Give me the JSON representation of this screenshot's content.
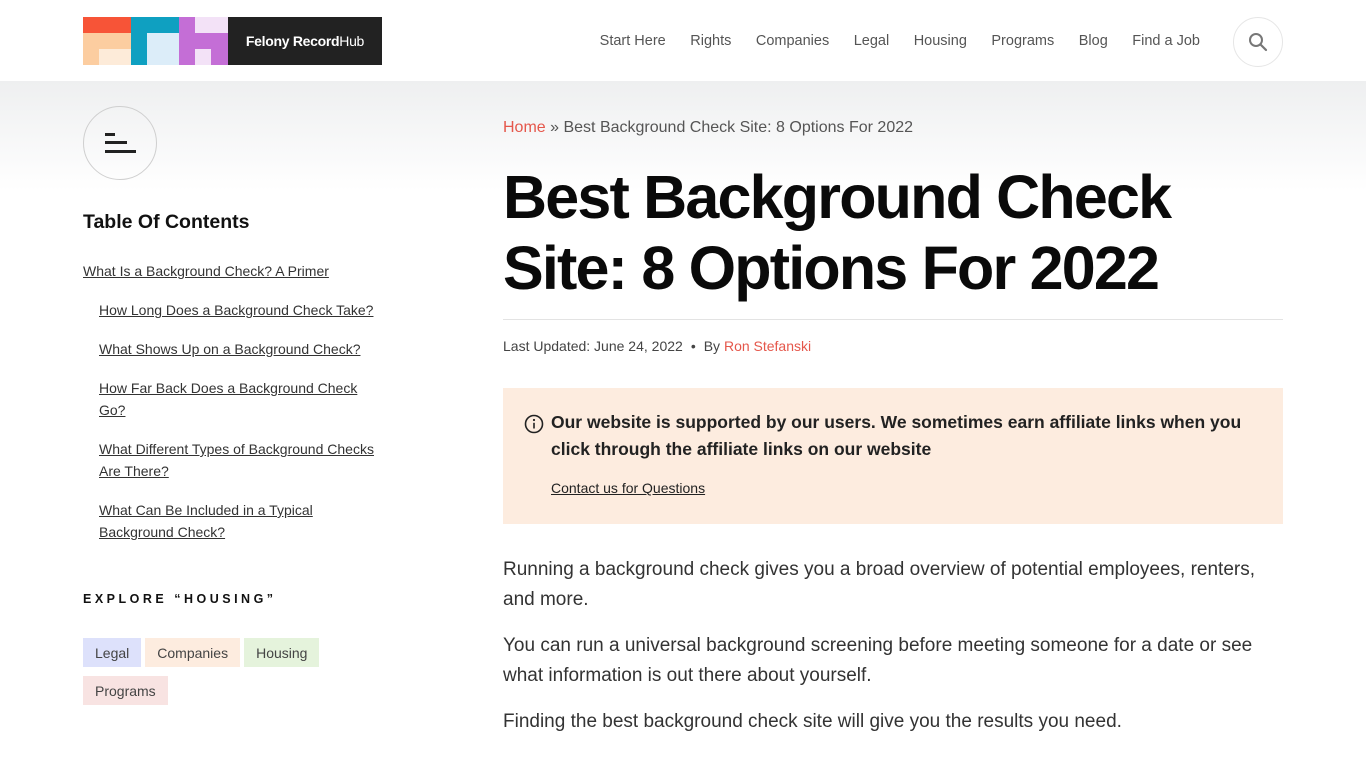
{
  "header": {
    "logo": {
      "brand_bold": "Felony Record",
      "brand_light": " Hub",
      "colors": {
        "red": "#f75437",
        "peach": "#fccda0",
        "cream": "#fdebd9",
        "teal": "#0fa0c1",
        "ice": "#dcedf9",
        "purple": "#c46ed6",
        "lavender": "#f3e2f7",
        "dark": "#222222"
      }
    },
    "nav": [
      {
        "label": "Start Here"
      },
      {
        "label": "Rights"
      },
      {
        "label": "Companies"
      },
      {
        "label": "Legal"
      },
      {
        "label": "Housing"
      },
      {
        "label": "Programs"
      },
      {
        "label": "Blog"
      },
      {
        "label": "Find a Job"
      }
    ],
    "search_icon": "search-icon"
  },
  "sidebar": {
    "toc_toggle_icon": "list-icon",
    "toc_title": "Table Of Contents",
    "toc_items": [
      {
        "label": "What Is a Background Check? A Primer",
        "level": 1
      },
      {
        "label": "How Long Does a Background Check Take?",
        "level": 2
      },
      {
        "label": "What Shows Up on a Background Check?",
        "level": 2
      },
      {
        "label": "How Far Back Does a Background Check Go?",
        "level": 2
      },
      {
        "label": "What Different Types of Background Checks Are There?",
        "level": 2
      },
      {
        "label": "What Can Be Included in a Typical Background Check?",
        "level": 2
      }
    ],
    "explore_title": "EXPLORE “HOUSING”",
    "tags": [
      {
        "label": "Legal",
        "color": "#dde1fb"
      },
      {
        "label": "Companies",
        "color": "#fdecdf"
      },
      {
        "label": "Housing",
        "color": "#e5f3dc"
      },
      {
        "label": "Programs",
        "color": "#f8e3e2"
      }
    ]
  },
  "main": {
    "breadcrumb": {
      "home": "Home",
      "separator": " » ",
      "current": "Best Background Check Site: 8 Options For 2022"
    },
    "title": "Best Background Check Site: 8 Options For 2022",
    "meta": {
      "updated": "Last Updated: June 24, 2022",
      "dot": "•",
      "by": "By ",
      "author": "Ron Stefanski"
    },
    "notice": {
      "icon": "info-icon",
      "text": "Our website is supported by our users. We sometimes earn affiliate links when you click through the affiliate links on our website",
      "link": "Contact us for Questions"
    },
    "paragraphs": [
      "Running a background check gives you a broad overview of potential employees, renters, and more.",
      "You can run a universal background screening before meeting someone for a date or see what information is out there about yourself.",
      "Finding the best background check site will give you the results you need."
    ],
    "accent_color": "#e5574b"
  }
}
